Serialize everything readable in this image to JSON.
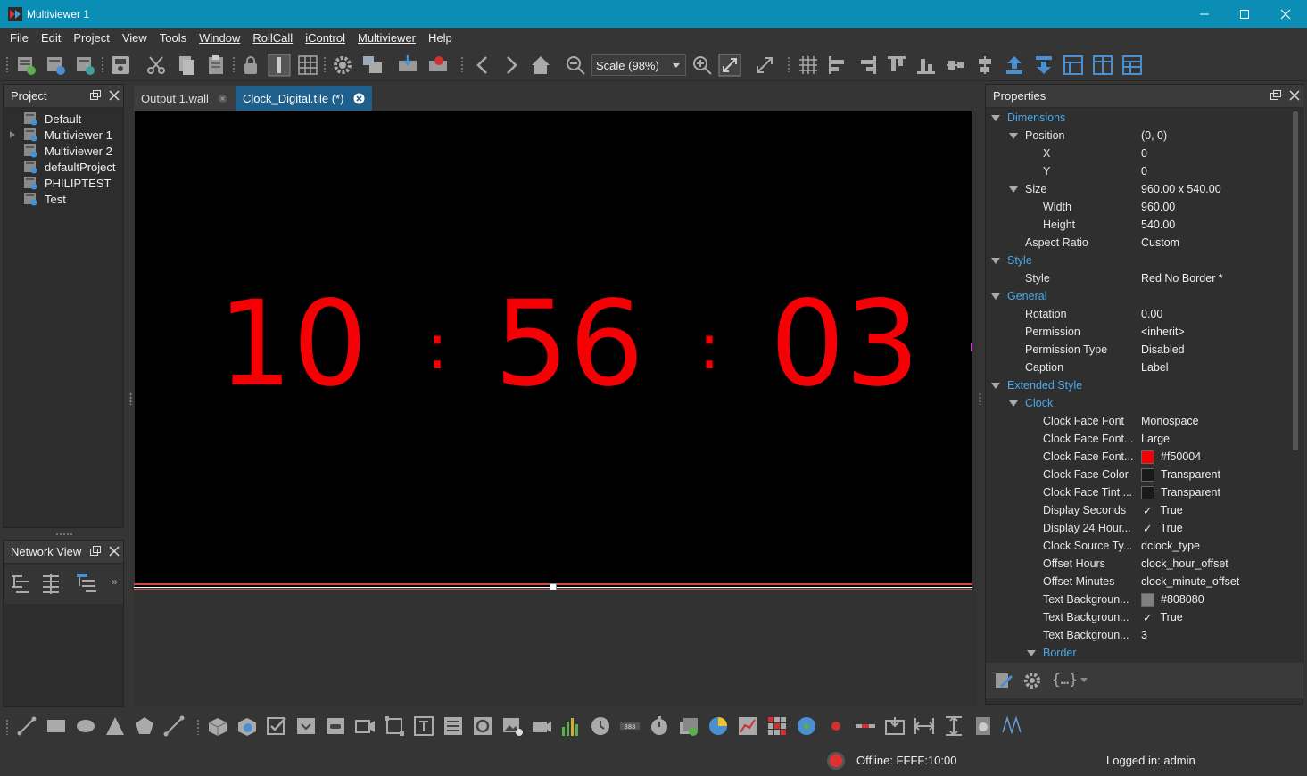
{
  "window": {
    "title": "Multiviewer 1"
  },
  "menu": [
    "File",
    "Edit",
    "Project",
    "View",
    "Tools",
    "Window",
    "RollCall",
    "iControl",
    "Multiviewer",
    "Help"
  ],
  "toolbar": {
    "scale_label": "Scale (98%)"
  },
  "project_panel": {
    "title": "Project",
    "items": [
      "Default",
      "Multiviewer 1",
      "Multiviewer 2",
      "defaultProject",
      "PHILIPTEST",
      "Test"
    ]
  },
  "network_panel": {
    "title": "Network View"
  },
  "tabs": [
    {
      "label": "Output 1.wall"
    },
    {
      "label": "Clock_Digital.tile (*)"
    }
  ],
  "clock": {
    "hours": "10",
    "minutes": "56",
    "seconds": "03",
    "color": "#f50004"
  },
  "properties": {
    "title": "Properties",
    "rows": [
      {
        "name": "Dimensions",
        "value": "",
        "group": true
      },
      {
        "name": "Position",
        "value": "(0, 0)"
      },
      {
        "name": "X",
        "value": "0"
      },
      {
        "name": "Y",
        "value": "0"
      },
      {
        "name": "Size",
        "value": "960.00 x 540.00"
      },
      {
        "name": "Width",
        "value": "960.00"
      },
      {
        "name": "Height",
        "value": "540.00"
      },
      {
        "name": "Aspect Ratio",
        "value": "Custom"
      },
      {
        "name": "Style",
        "value": "",
        "group": true
      },
      {
        "name": "Style",
        "value": "Red No Border *"
      },
      {
        "name": "General",
        "value": "",
        "group": true
      },
      {
        "name": "Rotation",
        "value": "0.00"
      },
      {
        "name": "Permission",
        "value": "<inherit>"
      },
      {
        "name": "Permission Type",
        "value": "Disabled"
      },
      {
        "name": "Caption",
        "value": "Label"
      },
      {
        "name": "Extended Style",
        "value": "",
        "group": true
      },
      {
        "name": "Clock",
        "value": "",
        "group": true
      },
      {
        "name": "Clock Face Font",
        "value": "Monospace"
      },
      {
        "name": "Clock Face Font...",
        "value": "Large"
      },
      {
        "name": "Clock Face Font...",
        "value": "#f50004",
        "swatch": "#f50004"
      },
      {
        "name": "Clock Face Color",
        "value": "Transparent",
        "swatch": "transparent"
      },
      {
        "name": "Clock Face Tint ...",
        "value": "Transparent",
        "swatch": "transparent"
      },
      {
        "name": "Display Seconds",
        "value": "True",
        "check": true
      },
      {
        "name": "Display 24 Hour...",
        "value": "True",
        "check": true
      },
      {
        "name": "Clock Source Ty...",
        "value": "dclock_type"
      },
      {
        "name": "Offset Hours",
        "value": "clock_hour_offset"
      },
      {
        "name": "Offset Minutes",
        "value": "clock_minute_offset"
      },
      {
        "name": "Text Backgroun...",
        "value": "#808080",
        "swatch": "#808080"
      },
      {
        "name": "Text Backgroun...",
        "value": "True",
        "check": true
      },
      {
        "name": "Text Backgroun...",
        "value": "3"
      },
      {
        "name": "Border",
        "value": "",
        "group": true
      }
    ]
  },
  "status": {
    "offline": "Offline: FFFF:10:00",
    "login": "Logged in: admin"
  },
  "colors": {
    "title_bar": "#0a8eb6",
    "group_text": "#4aa8e8",
    "active_tab": "#1e5f8c",
    "clock_red": "#f50004"
  }
}
